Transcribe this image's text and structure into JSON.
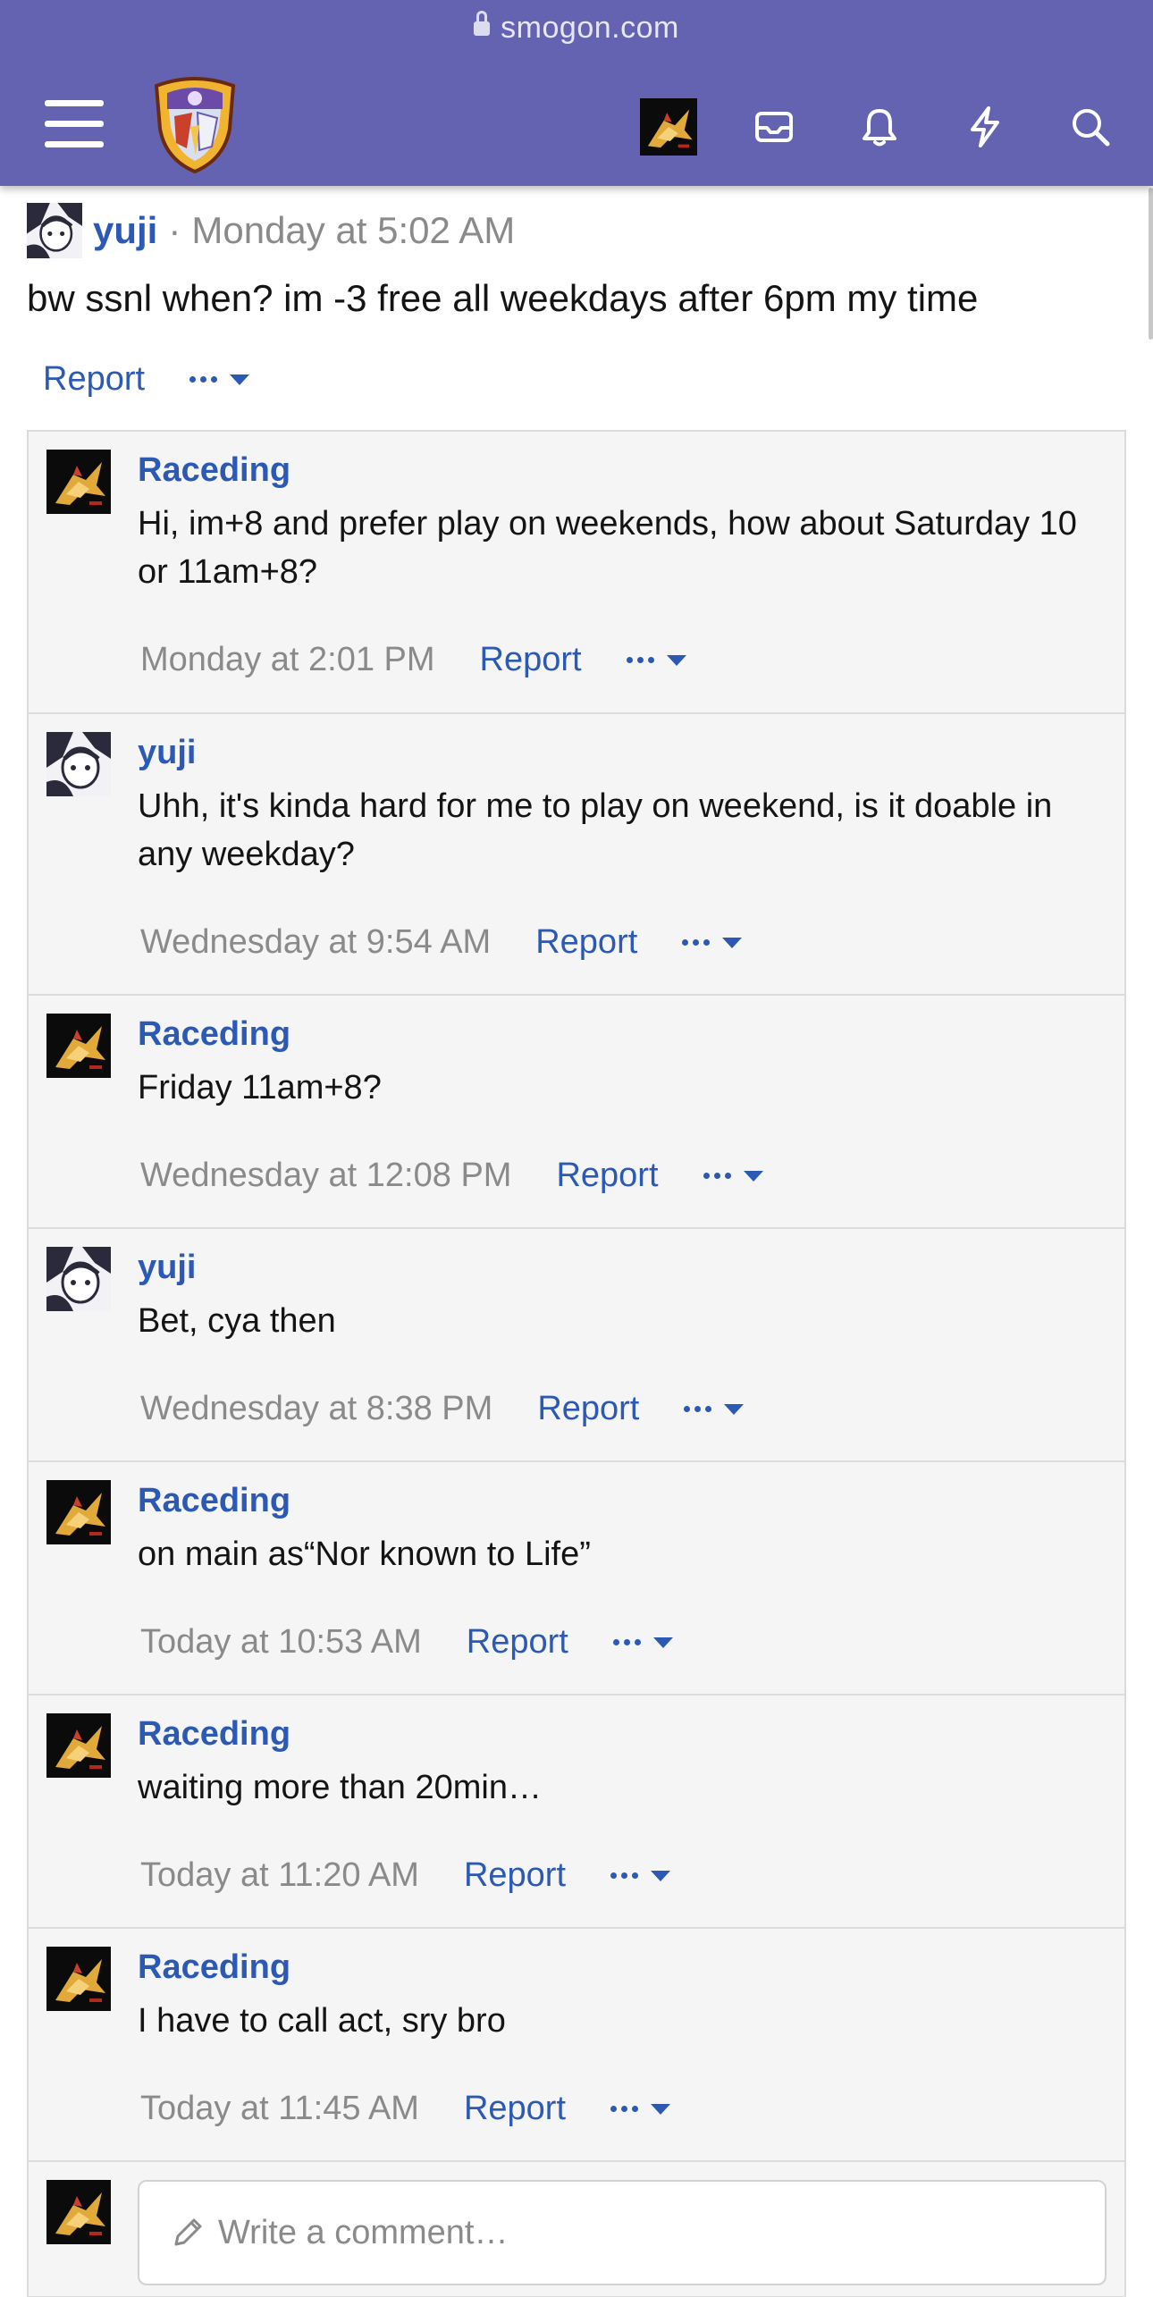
{
  "browser": {
    "url": "smogon.com"
  },
  "nav": {
    "icons": [
      "menu-icon",
      "site-logo",
      "user-avatar",
      "mail-icon",
      "bell-icon",
      "bolt-icon",
      "search-icon"
    ]
  },
  "post": {
    "author": "yuji",
    "separator": "·",
    "time": "Monday at 5:02 AM",
    "body": "bw ssnl when? im -3 free all weekdays after 6pm my time",
    "report_label": "Report"
  },
  "comments": [
    {
      "author": "Raceding",
      "text": "Hi, im+8 and prefer play on weekends, how about Saturday 10 or 11am+8?",
      "time": "Monday at 2:01 PM",
      "report": "Report"
    },
    {
      "author": "yuji",
      "text": "Uhh, it's kinda hard for me to play on weekend, is it doable in any weekday?",
      "time": "Wednesday at 9:54 AM",
      "report": "Report"
    },
    {
      "author": "Raceding",
      "text": "Friday 11am+8?",
      "time": "Wednesday at 12:08 PM",
      "report": "Report"
    },
    {
      "author": "yuji",
      "text": "Bet, cya then",
      "time": "Wednesday at 8:38 PM",
      "report": "Report"
    },
    {
      "author": "Raceding",
      "text": "on main as“Nor known to Life”",
      "time": "Today at 10:53 AM",
      "report": "Report"
    },
    {
      "author": "Raceding",
      "text": "waiting more than 20min…",
      "time": "Today at 11:20 AM",
      "report": "Report"
    },
    {
      "author": "Raceding",
      "text": "I have to call act, sry bro",
      "time": "Today at 11:45 AM",
      "report": "Report"
    }
  ],
  "comment_box": {
    "placeholder": "Write a comment…"
  },
  "colors": {
    "header": "#6363b1",
    "link": "#2c59b4",
    "muted": "#8a8a8a",
    "panel": "#f5f5f5"
  }
}
